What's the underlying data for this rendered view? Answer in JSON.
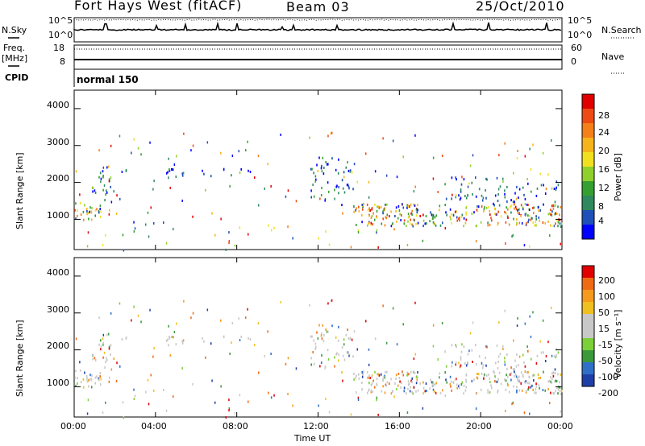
{
  "header": {
    "station": "Fort Hays West (fitACF)",
    "beam": "Beam 03",
    "date": "25/Oct/2010"
  },
  "left_labels": {
    "nsky": "N.Sky",
    "freq": "Freq.",
    "mhz": "[MHz]",
    "cpid": "CPID"
  },
  "right_labels": {
    "nsearch": "N.Search",
    "nave": "Nave"
  },
  "noise_panel": {
    "left_ticks": [
      "10^5",
      "10^0"
    ],
    "right_ticks": [
      "10^5",
      "10^0"
    ]
  },
  "freq_panel": {
    "left_ticks": [
      "18",
      "8"
    ],
    "right_ticks": [
      "60",
      "0"
    ]
  },
  "cpid_text": "normal 150",
  "chart_data": [
    {
      "type": "heatmap",
      "name": "power",
      "ylabel": "Slant Range [km]",
      "xlabel": "",
      "ylim": [
        180,
        4500
      ],
      "yticks": [
        "1000",
        "2000",
        "3000",
        "4000"
      ],
      "colorbar": {
        "label": "Power [dB]",
        "ticks": [
          "4",
          "8",
          "12",
          "16",
          "20",
          "24",
          "28"
        ],
        "colors": [
          "#0000ff",
          "#1f4fb8",
          "#2e8a5e",
          "#35a02f",
          "#8fd02d",
          "#f0e020",
          "#f5b31c",
          "#f57f18",
          "#ee4a14",
          "#e00000"
        ]
      },
      "bands": [
        {
          "t0": 0.0,
          "t1": 1.3,
          "r0": 1000,
          "r1": 1500,
          "v": 0.7
        },
        {
          "t0": 0.8,
          "t1": 1.8,
          "r0": 1500,
          "r1": 2200,
          "v": 0.35
        },
        {
          "t0": 1.2,
          "t1": 2.6,
          "r0": 2100,
          "r1": 2450,
          "v": 0.3
        },
        {
          "t0": 4.5,
          "t1": 9.0,
          "r0": 2150,
          "r1": 2400,
          "v": 0.3
        },
        {
          "t0": 11.6,
          "t1": 13.8,
          "r0": 1400,
          "r1": 2700,
          "v": 0.3
        },
        {
          "t0": 13.7,
          "t1": 24.0,
          "r0": 850,
          "r1": 1450,
          "v": 0.75
        },
        {
          "t0": 18.0,
          "t1": 24.0,
          "r0": 1500,
          "r1": 2200,
          "v": 0.25
        }
      ]
    },
    {
      "type": "heatmap",
      "name": "velocity",
      "ylabel": "Slant Range [km]",
      "xlabel": "Time UT",
      "ylim": [
        180,
        4500
      ],
      "yticks": [
        "1000",
        "2000",
        "3000",
        "4000"
      ],
      "xticks": [
        "00:00",
        "04:00",
        "08:00",
        "12:00",
        "16:00",
        "20:00",
        "00:00"
      ],
      "xlim": [
        0,
        24
      ],
      "colorbar": {
        "label": "Velocity [m s⁻¹]",
        "ticks": [
          "200",
          "100",
          "50",
          "15",
          "-15",
          "-50",
          "-100",
          "-200"
        ],
        "colors": [
          "#1f3fa8",
          "#2f6fc8",
          "#3a9a3a",
          "#7cd037",
          "#c8c8c8",
          "#c8c8c8",
          "#f0c020",
          "#f59a1c",
          "#f06a14",
          "#e00000"
        ]
      }
    }
  ]
}
